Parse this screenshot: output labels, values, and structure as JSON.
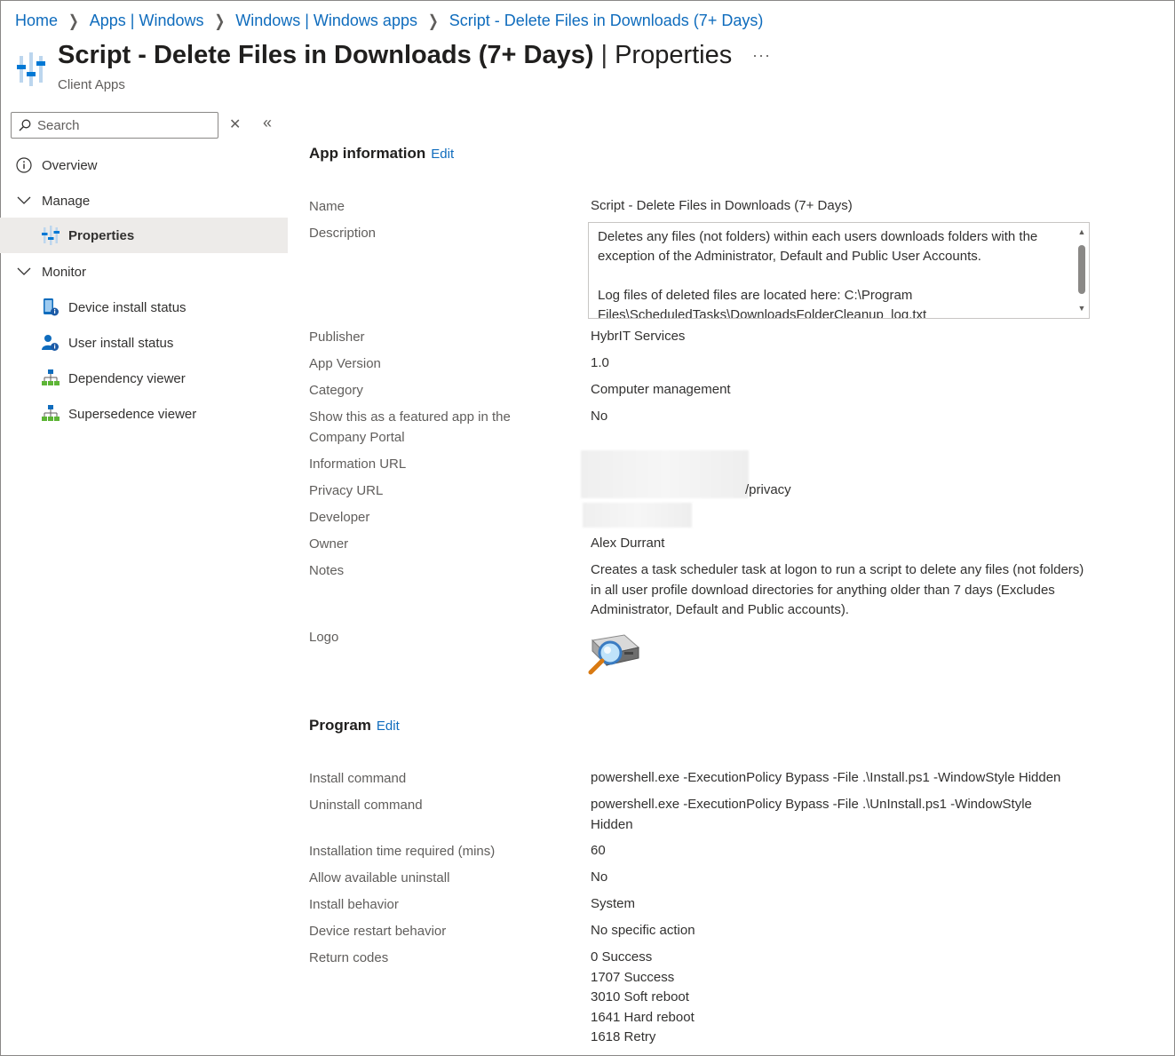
{
  "breadcrumb": [
    {
      "label": "Home"
    },
    {
      "label": "Apps | Windows"
    },
    {
      "label": "Windows | Windows apps"
    },
    {
      "label": "Script - Delete Files in Downloads (7+ Days)"
    }
  ],
  "header": {
    "title": "Script - Delete Files in Downloads (7+ Days)",
    "separator": "|",
    "section": "Properties",
    "more": "···",
    "subtitle": "Client Apps"
  },
  "sidebar": {
    "search_placeholder": "Search",
    "clear_icon": "close-icon",
    "collapse_icon": "double-chevron-left-icon",
    "items": [
      {
        "label": "Overview",
        "icon": "info-icon"
      },
      {
        "label": "Manage",
        "icon": "chevron-down-icon"
      },
      {
        "label": "Properties",
        "icon": "properties-icon",
        "active": true
      },
      {
        "label": "Monitor",
        "icon": "chevron-down-icon"
      },
      {
        "label": "Device install status",
        "icon": "device-status-icon"
      },
      {
        "label": "User install status",
        "icon": "user-status-icon"
      },
      {
        "label": "Dependency viewer",
        "icon": "hierarchy-icon"
      },
      {
        "label": "Supersedence viewer",
        "icon": "hierarchy-icon"
      }
    ]
  },
  "app_info": {
    "title": "App information",
    "edit": "Edit",
    "fields": {
      "name": {
        "label": "Name",
        "value": "Script - Delete Files in Downloads (7+ Days)"
      },
      "description": {
        "label": "Description",
        "value": "Deletes any files (not folders) within each users downloads folders with the exception of the Administrator, Default and Public User Accounts.\n\nLog files of deleted files are located here: C:\\Program Files\\ScheduledTasks\\DownloadsFolderCleanup_log.txt"
      },
      "publisher": {
        "label": "Publisher",
        "value": "HybrIT Services"
      },
      "app_version": {
        "label": "App Version",
        "value": "1.0"
      },
      "category": {
        "label": "Category",
        "value": "Computer management"
      },
      "featured": {
        "label": "Show this as a featured app in the Company Portal",
        "value": "No"
      },
      "info_url": {
        "label": "Information URL",
        "value": ""
      },
      "privacy_url": {
        "label": "Privacy URL",
        "value": "/privacy"
      },
      "developer": {
        "label": "Developer",
        "value": ""
      },
      "owner": {
        "label": "Owner",
        "value": "Alex Durrant"
      },
      "notes": {
        "label": "Notes",
        "value": "Creates a task scheduler task at logon to run a script to delete any files (not folders) in all user profile download directories for anything older than 7 days (Excludes Administrator, Default and Public accounts)."
      },
      "logo": {
        "label": "Logo",
        "icon": "drive-search-icon"
      }
    }
  },
  "program": {
    "title": "Program",
    "edit": "Edit",
    "fields": {
      "install": {
        "label": "Install command",
        "value": "powershell.exe -ExecutionPolicy Bypass -File .\\Install.ps1 -WindowStyle Hidden"
      },
      "uninstall": {
        "label": "Uninstall command",
        "value": "powershell.exe -ExecutionPolicy Bypass -File .\\UnInstall.ps1 -WindowStyle Hidden"
      },
      "time": {
        "label": "Installation time required (mins)",
        "value": "60"
      },
      "allow_uninstall": {
        "label": "Allow available uninstall",
        "value": "No"
      },
      "behavior": {
        "label": "Install behavior",
        "value": "System"
      },
      "restart": {
        "label": "Device restart behavior",
        "value": "No specific action"
      },
      "return_codes": {
        "label": "Return codes",
        "values": [
          "0 Success",
          "1707 Success",
          "3010 Soft reboot",
          "1641 Hard reboot",
          "1618 Retry"
        ]
      }
    }
  },
  "colors": {
    "link": "#0f6cbd",
    "active_bg": "#edebe9",
    "text": "#323130",
    "label": "#605e5c"
  }
}
